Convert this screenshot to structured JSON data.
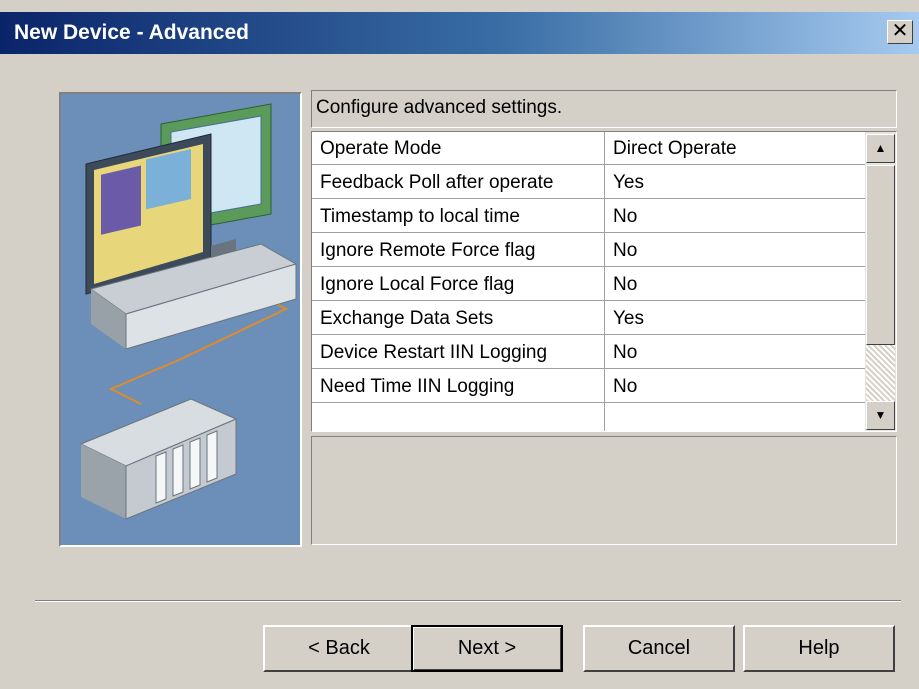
{
  "window": {
    "title": "New Device - Advanced",
    "close_glyph": "✕"
  },
  "description": "Configure advanced settings.",
  "properties": [
    {
      "name": "Operate Mode",
      "value": "Direct Operate"
    },
    {
      "name": "Feedback Poll after operate",
      "value": "Yes"
    },
    {
      "name": "Timestamp to local time",
      "value": "No"
    },
    {
      "name": "Ignore Remote Force flag",
      "value": "No"
    },
    {
      "name": "Ignore Local Force flag",
      "value": "No"
    },
    {
      "name": "Exchange Data Sets",
      "value": "Yes"
    },
    {
      "name": "Device Restart IIN Logging",
      "value": "No"
    },
    {
      "name": "Need Time IIN Logging",
      "value": "No"
    },
    {
      "name": "",
      "value": ""
    }
  ],
  "scroll": {
    "up_glyph": "▲",
    "down_glyph": "▼"
  },
  "buttons": {
    "back": "< Back",
    "next": "Next >",
    "cancel": "Cancel",
    "help": "Help"
  },
  "colors": {
    "title_start": "#0a246a",
    "title_end": "#a6caf0",
    "face": "#d4d0c8",
    "graphic_bg": "#6b8fb8"
  }
}
